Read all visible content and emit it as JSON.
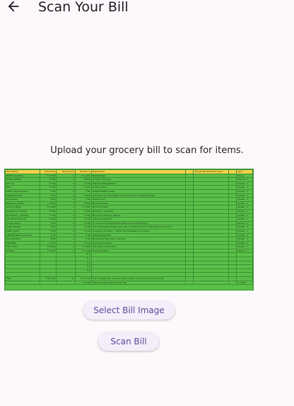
{
  "header": {
    "title": "Scan Your Bill",
    "back_icon": "arrow-left-icon"
  },
  "prompt": "Upload your grocery bill to scan for items.",
  "bill_image": {
    "columns": [
      "Item Name",
      "Item Price",
      "Item Quant",
      "Total Price",
      "Explanation",
      "",
      "Things We Have Borrowed",
      "",
      "Split"
    ],
    "rows": [
      [
        "ESP32 Dev Boar",
        "₹ 1,200",
        "1",
        "₹ 1,200",
        "Not Needed",
        "",
        "",
        "",
        "Divya"
      ],
      [
        "Hiletgo PN532",
        "₹ 620",
        "1",
        "₹ 620",
        "Location Tracking",
        "",
        "",
        "",
        "Harshit - 1"
      ],
      [
        "DHT 11",
        "₹ 120",
        "1",
        "₹ 120",
        "Heat and Temperature",
        "",
        "",
        "",
        "Suvam - 1"
      ],
      [
        "MQ 2",
        "₹ 120",
        "1",
        "₹ 120",
        "Smoke Sensor",
        "",
        "",
        "",
        "Suvam - 1"
      ],
      [
        "Water Level Sensors",
        "₹ 40",
        "2",
        "₹ 80",
        "Detects Water Levels",
        "",
        "",
        "",
        "Suvam - 1"
      ],
      [
        "Potentiometers",
        "₹ 50",
        "2",
        "₹ 100",
        "Simulates and Simulates an Environment to Test the Robot",
        "",
        "",
        "",
        "Suvam - 1"
      ],
      [
        "Fire Sensor",
        "₹ 60",
        "1",
        "₹ 60",
        "Detects Fire",
        "",
        "",
        "",
        "Suvam - 1"
      ],
      [
        "Raspberry Pi Pico",
        "₹ 550",
        "1",
        "₹ 550",
        "Microcontroller",
        "",
        "",
        "",
        "Anshit - 1"
      ],
      [
        "Arduino Mega",
        "₹ 1,100",
        "1",
        "₹ 1,100",
        "Microcontroller",
        "",
        "",
        "",
        "Suvam - 1"
      ],
      [
        "Raspberry Pi Shield",
        "₹ 600",
        "1",
        "₹ 600",
        "Extender / Upgrade",
        "",
        "",
        "",
        "Anshit - 1"
      ],
      [
        "DC Motors + Wheels",
        "₹ 100",
        "4",
        "₹ 400",
        "Moves the Robot to Places",
        "",
        "",
        "",
        "Anshit - 4"
      ],
      [
        "Ultrasonic Sensors",
        "₹ 100",
        "1",
        "₹ 100",
        "Image Recognition",
        "",
        "",
        "",
        "Anshit - 1"
      ],
      [
        "Jumper Wires",
        "₹ 50",
        "2",
        "₹ 100",
        "To connect Out Equipment (Boards & Stuff Together)",
        "",
        "",
        "",
        "Harshit - 1"
      ],
      [
        "Relay Module",
        "₹ 50",
        "2",
        "₹ 100",
        "Can isolate/deactivate faulty device while the rest of the system functions",
        "",
        "",
        "",
        "Suvam - 1"
      ],
      [
        "Water Pump",
        "₹ 80",
        "2",
        "₹ 160",
        "To pump out water — NOTE: Not available on Amazon",
        "",
        "",
        "",
        "Suvam - 1"
      ],
      [
        "LM2596 Buck Converter",
        "₹ 40",
        "1",
        "₹ 40",
        "Voltage Regulator",
        "",
        "",
        "",
        "Suvam - 1"
      ],
      [
        "Servo Motors",
        "₹ 90",
        "1",
        "₹ 90",
        "Moving the Ultra Sonic Sensors",
        "",
        "",
        "",
        "Suvam - 1"
      ],
      [
        "MPU6050",
        "₹ 270",
        "1",
        "₹ 270",
        "Gyroscopic Sensor",
        "",
        "",
        "",
        "Anshit - 1"
      ],
      [
        "Fabrication",
        "₹ 2,000",
        "1",
        "₹ 2,000",
        "The Body of the Robot",
        "",
        "",
        "",
        "Suvam - 1"
      ],
      [
        "Printing",
        "₹ 1,240",
        "1",
        "₹ 1,240",
        "Printing of Files",
        "",
        "",
        "",
        "Harshit - 1"
      ],
      [
        "",
        "",
        "",
        "₹ 0",
        "",
        "",
        "",
        "",
        ""
      ],
      [
        "",
        "",
        "",
        "₹ 0",
        "",
        "",
        "",
        "",
        ""
      ],
      [
        "",
        "",
        "",
        "₹ 0",
        "",
        "",
        "",
        "",
        ""
      ],
      [
        "",
        "",
        "",
        "₹ 0",
        "",
        "",
        "",
        "",
        ""
      ],
      [
        "",
        "",
        "",
        "₹ 0",
        "",
        "",
        "",
        "",
        ""
      ],
      [
        "",
        "",
        "",
        "",
        "",
        "",
        "",
        "",
        ""
      ],
      [
        "Total",
        "₹ 10,797",
        "37",
        "₹ 10,730",
        "The average item and the Total number of items and the total price.",
        "",
        "",
        "",
        ""
      ],
      [
        "",
        "",
        "",
        "₹ 5,730",
        "The Cost without the Printer Fee",
        "",
        "",
        "",
        "₹ 3,200"
      ]
    ]
  },
  "actions": {
    "select_label": "Select Bill Image",
    "scan_label": "Scan Bill"
  },
  "colors": {
    "sheet_green": "#59c048",
    "header_yellow": "#f3d24a",
    "button_text": "#5b4a9a",
    "background": "#fdf8fc"
  }
}
